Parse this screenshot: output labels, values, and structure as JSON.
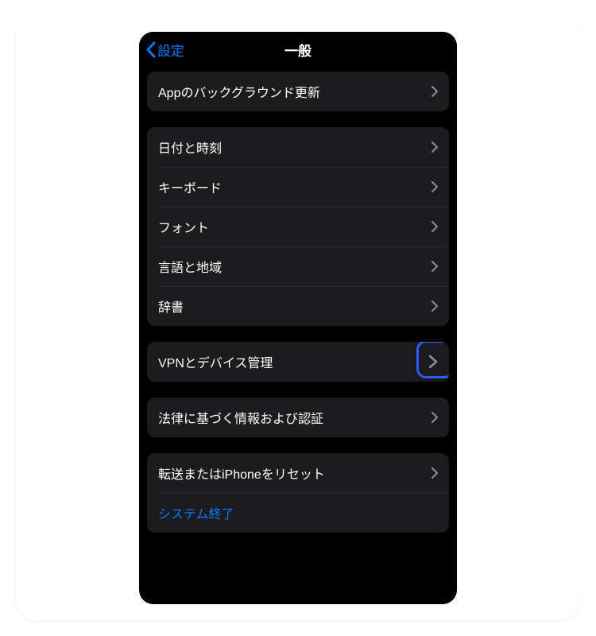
{
  "nav": {
    "back_label": "設定",
    "title": "一般"
  },
  "groups": [
    {
      "items": [
        {
          "label": "Appのバックグラウンド更新",
          "type": "disclosure"
        }
      ]
    },
    {
      "items": [
        {
          "label": "日付と時刻",
          "type": "disclosure"
        },
        {
          "label": "キーボード",
          "type": "disclosure"
        },
        {
          "label": "フォント",
          "type": "disclosure"
        },
        {
          "label": "言語と地域",
          "type": "disclosure"
        },
        {
          "label": "辞書",
          "type": "disclosure"
        }
      ]
    },
    {
      "items": [
        {
          "label": "VPNとデバイス管理",
          "type": "disclosure",
          "highlighted": true
        }
      ]
    },
    {
      "items": [
        {
          "label": "法律に基づく情報および認証",
          "type": "disclosure"
        }
      ]
    },
    {
      "items": [
        {
          "label": "転送またはiPhoneをリセット",
          "type": "disclosure"
        },
        {
          "label": "システム終了",
          "type": "link"
        }
      ]
    }
  ],
  "colors": {
    "accent": "#0a7aff",
    "highlight_ring": "#2f5bff",
    "background": "#000000",
    "cell": "#1c1c1e",
    "chevron": "#8e8e93"
  }
}
